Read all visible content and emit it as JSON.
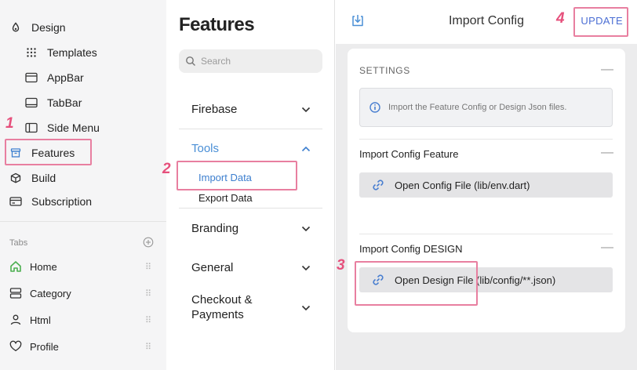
{
  "sidebar": {
    "items": [
      {
        "label": "Design",
        "icon": "palette-icon"
      },
      {
        "label": "Templates",
        "icon": "grid-icon"
      },
      {
        "label": "AppBar",
        "icon": "appbar-icon"
      },
      {
        "label": "TabBar",
        "icon": "tabbar-icon"
      },
      {
        "label": "Side Menu",
        "icon": "side-menu-icon"
      },
      {
        "label": "Features",
        "icon": "archive-icon"
      },
      {
        "label": "Build",
        "icon": "cube-icon"
      },
      {
        "label": "Subscription",
        "icon": "card-icon"
      }
    ],
    "tabs_label": "Tabs",
    "tabs": [
      {
        "label": "Home",
        "icon": "home-icon"
      },
      {
        "label": "Category",
        "icon": "category-icon"
      },
      {
        "label": "Html",
        "icon": "user-icon"
      },
      {
        "label": "Profile",
        "icon": "heart-icon"
      }
    ]
  },
  "middle": {
    "title": "Features",
    "search_placeholder": "Search",
    "sections": [
      {
        "label": "Firebase"
      },
      {
        "label": "Tools"
      },
      {
        "label": "Branding"
      },
      {
        "label": "General"
      },
      {
        "label": "Checkout &",
        "label2": "Payments"
      }
    ],
    "tools_items": [
      {
        "label": "Import Data"
      },
      {
        "label": "Export Data"
      }
    ]
  },
  "right": {
    "title": "Import Config",
    "update_label": "UPDATE",
    "settings_label": "SETTINGS",
    "info_text": "Import the Feature Config or Design Json files.",
    "feature_label": "Import Config Feature",
    "feature_button": "Open Config File (lib/env.dart)",
    "design_label": "Import Config DESIGN",
    "design_button": "Open Design File (lib/config/**.json)",
    "collapse_symbol": "—"
  },
  "annotations": [
    "1",
    "2",
    "3",
    "4"
  ],
  "colors": {
    "accent": "#4a8fd6",
    "highlight": "#e87fa0",
    "badge": "#e6507c",
    "home_icon": "#4caf50"
  }
}
